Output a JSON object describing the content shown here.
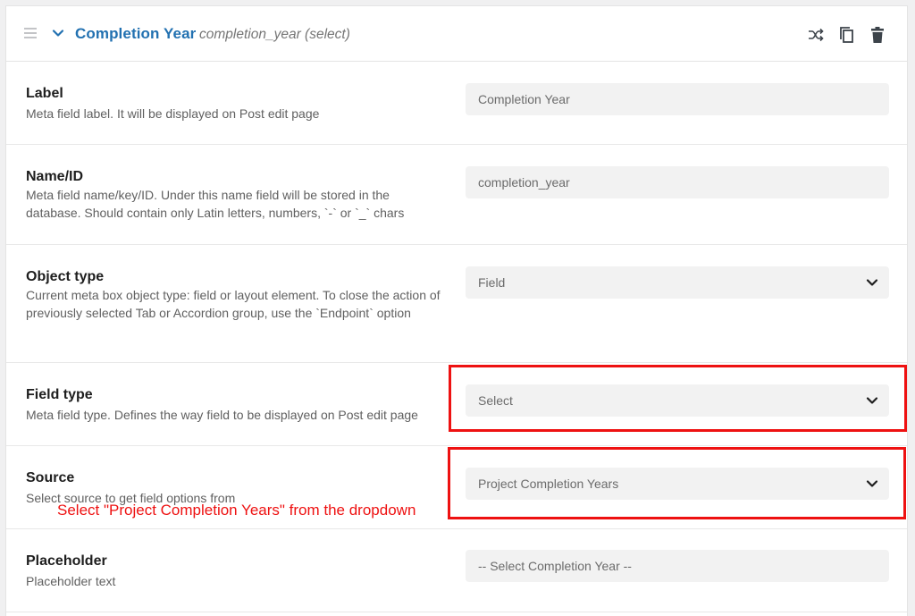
{
  "header": {
    "title": "Completion Year",
    "subtitle": "completion_year (select)",
    "icons": [
      "drag-handle-icon",
      "chevron-down-icon",
      "shuffle-icon",
      "copy-icon",
      "trash-icon"
    ]
  },
  "fields": {
    "label": {
      "title": "Label",
      "description": "Meta field label. It will be displayed on Post edit page",
      "value": "Completion Year"
    },
    "name_id": {
      "title": "Name/ID",
      "description": "Meta field name/key/ID. Under this name field will be stored in the database. Should contain only Latin letters, numbers, `-` or `_` chars",
      "value": "completion_year"
    },
    "object_type": {
      "title": "Object type",
      "description": "Current meta box object type: field or layout element. To close the action of previously selected Tab or Accordion group, use the `Endpoint` option",
      "value": "Field"
    },
    "field_type": {
      "title": "Field type",
      "description": "Meta field type. Defines the way field to be displayed on Post edit page",
      "value": "Select"
    },
    "source": {
      "title": "Source",
      "description": "Select source to get field options from",
      "value": "Project Completion Years"
    },
    "placeholder": {
      "title": "Placeholder",
      "description": "Placeholder text",
      "value": "-- Select Completion Year --"
    }
  },
  "annotation": {
    "text": "Select \"Project Completion Years\" from the dropdown",
    "color": "#ee1111"
  },
  "colors": {
    "accent": "#2271b1",
    "highlight": "#ee1111"
  }
}
